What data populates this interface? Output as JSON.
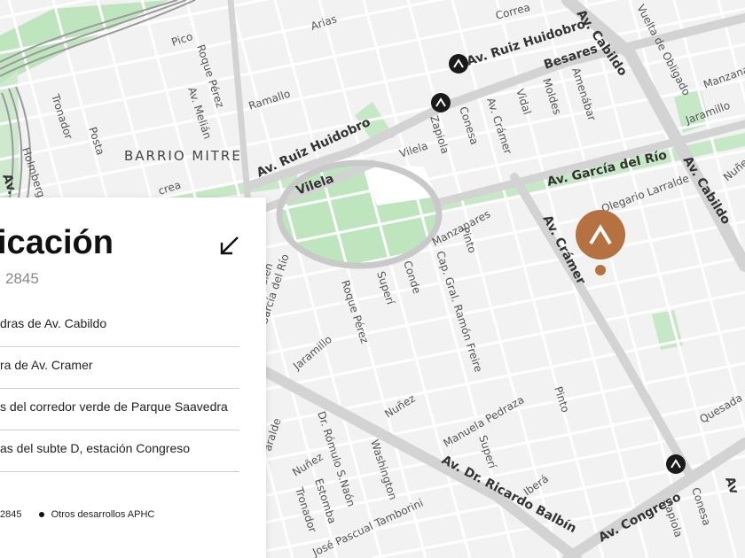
{
  "map": {
    "district_label": "BARRIO MITRE",
    "streets": {
      "correa": "Correa",
      "cabildo_top": "Av. Cabildo",
      "vuelta_obligado": "Vuelta de Obligado",
      "manzanares_top": "Manzanares",
      "jaramillo_top": "Jaramillo",
      "ruiz_huidobro_top": "Av. Ruiz Huidobro",
      "besares": "Besares",
      "amenabar": "Amenábar",
      "moldes": "Moldes",
      "vidal": "Vidal",
      "cramer_top": "Av. Crámer",
      "conesa_top": "Conesa",
      "zapiola_top": "Zapiola",
      "vilela_right": "Vilela",
      "arias": "Arias",
      "pico": "Pico",
      "roque_perez_top": "Roque Pérez",
      "ramallo": "Ramallo",
      "melian": "Av. Melián",
      "tronador_top": "Tronador",
      "posta": "Posta",
      "holmberg": "Holmberg",
      "ruiz_huidobro_mid": "Av. Ruiz Huidobro",
      "vilela_left": "Vilela",
      "garcia_del_rio_top": "Av. García del Río",
      "cabildo_right": "Av. Cabildo",
      "nunez_top": "Nuñez",
      "olegario": "Olegario Larralde",
      "cramer_main": "Av. Crámer",
      "manzanares_mid": "Manzanares",
      "pinto_top": "Pinto",
      "cap_gral": "Cap. Gral. Ramón Freire",
      "conde": "Conde",
      "superi_top": "Superí",
      "roque_perez_mid": "Roque Pérez",
      "garcia_del_rio_mid": "García del Río",
      "sien": "sien",
      "jaramillo_mid": "Jaramillo",
      "quesada": "Quesada",
      "nunez_mid": "Nuñez",
      "pinto_mid": "Pinto",
      "manuela_pedraza": "Manuela Pedraza",
      "larralde_left": "aralde",
      "romulo_naon": "Dr. Rómulo S.Naón",
      "washington": "Washington",
      "superi_bottom": "Superí",
      "ibera": "Iberá",
      "balbin": "Av. Dr. Ricardo Balbín",
      "nunez_bottom": "Nuñez",
      "estomba": "Estomba",
      "tronador_bottom": "Tronador",
      "pascual_tamborini": "José Pascual Tamborini",
      "congreso": "Av. Congreso",
      "zapiola_bottom": "Zapiola",
      "conesa_bottom": "Conesa",
      "av_left_top": "Av. F",
      "av_right_bottom": "Av",
      "crea": "crea"
    },
    "marker_icon": "caret-up-icon",
    "colors": {
      "background": "#f2f2f2",
      "park": "#bfe5bf",
      "major_road": "#cfcfcf",
      "marker_brown": "#b5713f",
      "marker_dark": "#1a1a1a"
    }
  },
  "panel": {
    "title": "icación",
    "address": "2845",
    "items": [
      "dras de Av. Cabildo",
      "ra de Av. Cramer",
      "s del corredor verde de Parque Saavedra",
      "as del subte D, estación Congreso"
    ],
    "legend": {
      "current": "2845",
      "others": "Otros desarrollos APHC"
    },
    "collapse_icon": "arrow-down-left-icon"
  }
}
